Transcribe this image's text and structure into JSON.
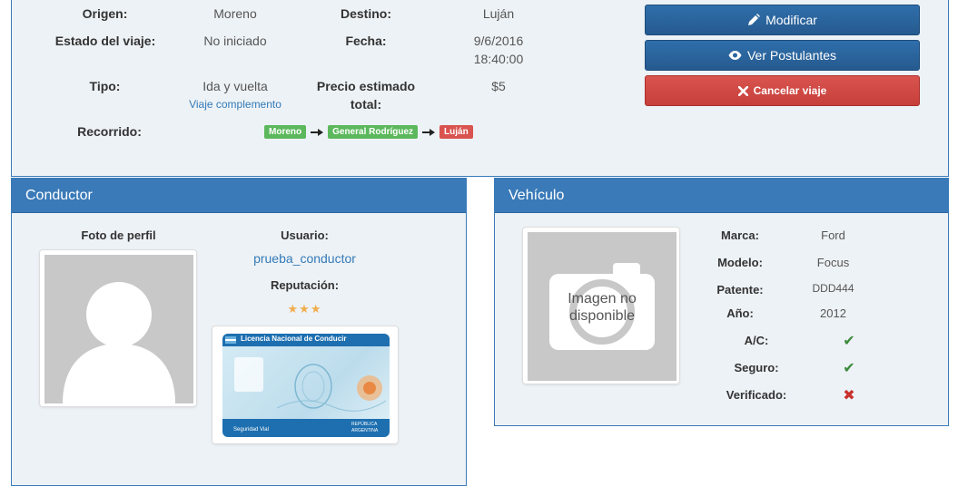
{
  "trip": {
    "origen_label": "Origen:",
    "origen_value": "Moreno",
    "destino_label": "Destino:",
    "destino_value": "Luján",
    "estado_label": "Estado del viaje:",
    "estado_value": "No iniciado",
    "fecha_label": "Fecha:",
    "fecha_date": "9/6/2016",
    "fecha_time": "18:40:00",
    "tipo_label": "Tipo:",
    "tipo_value": "Ida y vuelta",
    "tipo_link": "Viaje complemento",
    "precio_label_line1": "Precio estimado",
    "precio_label_line2": "total:",
    "precio_value": "$5",
    "recorrido_label": "Recorrido:",
    "route": [
      "Moreno",
      "General Rodríguez",
      "Luján"
    ]
  },
  "actions": {
    "modificar": "Modificar",
    "ver_postulantes": "Ver Postulantes",
    "cancelar": "Cancelar viaje"
  },
  "conductor": {
    "title": "Conductor",
    "foto_label": "Foto de perfil",
    "usuario_label": "Usuario:",
    "usuario_value": "prueba_conductor",
    "reputacion_label": "Reputación:",
    "reputacion_stars": "★★★",
    "reputacion_rating": 3,
    "licencia_header": "Licencia Nacional de Conducir",
    "licencia_footer_left": "Seguridad Vial",
    "licencia_footer_right_1": "REPÚBLICA",
    "licencia_footer_right_2": "ARGENTINA"
  },
  "vehiculo": {
    "title": "Vehículo",
    "image_placeholder_1": "Imagen no",
    "image_placeholder_2": "disponible",
    "marca_label": "Marca:",
    "marca_value": "Ford",
    "modelo_label": "Modelo:",
    "modelo_value": "Focus",
    "patente_label": "Patente:",
    "patente_value": "DDD444",
    "anio_label": "Año:",
    "anio_value": "2012",
    "ac_label": "A/C:",
    "ac_value": true,
    "seguro_label": "Seguro:",
    "seguro_value": true,
    "verificado_label": "Verificado:",
    "verificado_value": false
  },
  "colors": {
    "panel_bg": "#edf2f6",
    "header_blue": "#3a7ab8",
    "button_blue": "#2f6fab",
    "button_red": "#d9534f",
    "tag_green": "#5cb85c",
    "tag_red": "#d9534f",
    "star": "#f0ad4e"
  }
}
